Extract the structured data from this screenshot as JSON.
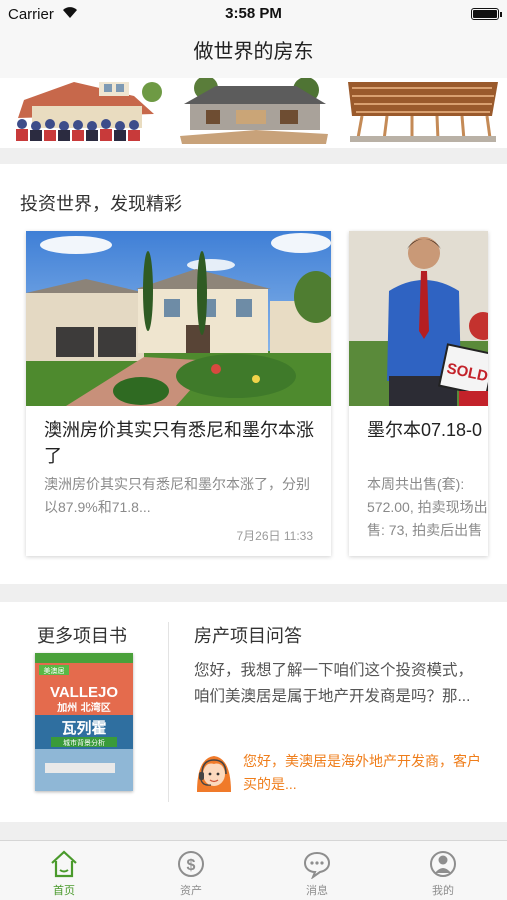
{
  "status_bar": {
    "carrier": "Carrier",
    "time": "3:58 PM",
    "battery_level": 1.0
  },
  "nav": {
    "title": "做世界的房东"
  },
  "invest_section": {
    "title": "投资世界，发现精彩",
    "cards": [
      {
        "title": "澳洲房价其实只有悉尼和墨尔本涨了",
        "summary": "澳洲房价其实只有悉尼和墨尔本涨了，分别以87.9%和71.8...",
        "date": "7月26日 11:33"
      },
      {
        "title": "墨尔本07.18-0",
        "summary": "本周共出售(套): 572.00, 拍卖现场出售: 73, 拍卖后出售",
        "sign_text": "SOLD"
      }
    ]
  },
  "more_projects": {
    "title": "更多项目书",
    "brochure": {
      "badge": "美澳居",
      "name_en": "VALLEJO",
      "location": "加州 北湾区",
      "name_cn": "瓦列霍",
      "subtitle": "城市背景分析"
    }
  },
  "qa": {
    "title": "房产项目问答",
    "question": "您好，我想了解一下咱们这个投资模式，咱们美澳居是属于地产开发商是吗？那...",
    "answer": "您好，美澳居是海外地产开发商，客户买的是..."
  },
  "tabbar": {
    "items": [
      {
        "label": "首页",
        "icon": "home-icon",
        "active": true
      },
      {
        "label": "资产",
        "icon": "dollar-icon",
        "active": false
      },
      {
        "label": "消息",
        "icon": "chat-icon",
        "active": false
      },
      {
        "label": "我的",
        "icon": "profile-icon",
        "active": false
      }
    ]
  },
  "colors": {
    "accent": "#4a9a2c",
    "answer": "#ef7d1a",
    "background": "#efefef"
  }
}
